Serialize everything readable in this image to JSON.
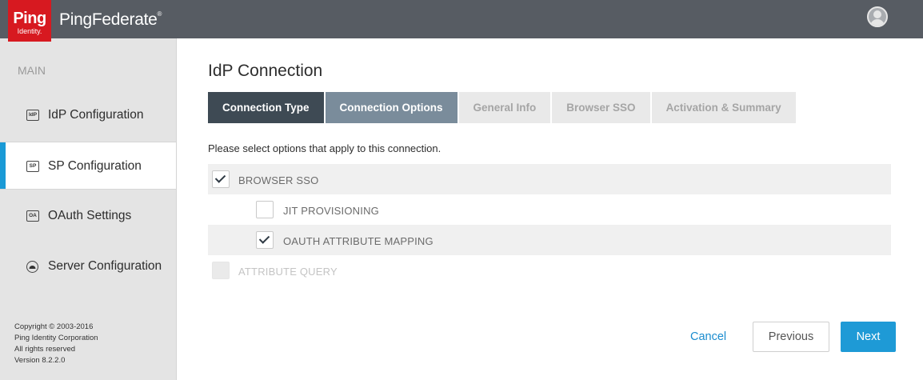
{
  "header": {
    "logo_main": "Ping",
    "logo_sub": "Identity.",
    "product_name": "PingFederate",
    "trademark": "®",
    "user_icon": "user-avatar-icon"
  },
  "sidebar": {
    "heading": "MAIN",
    "items": [
      {
        "label": "IdP Configuration",
        "icon_text": "IdP",
        "icon": "idp-icon",
        "active": false
      },
      {
        "label": "SP Configuration",
        "icon_text": "SP",
        "icon": "sp-icon",
        "active": true
      },
      {
        "label": "OAuth Settings",
        "icon_text": "OA",
        "icon": "oauth-icon",
        "active": false
      },
      {
        "label": "Server Configuration",
        "icon_text": "",
        "icon": "server-icon",
        "active": false
      }
    ],
    "copyright_lines": [
      "Copyright © 2003-2016",
      "Ping Identity Corporation",
      "All rights reserved",
      "Version 8.2.2.0"
    ]
  },
  "main": {
    "title": "IdP Connection",
    "tabs": [
      {
        "label": "Connection Type",
        "state": "done"
      },
      {
        "label": "Connection Options",
        "state": "current"
      },
      {
        "label": "General Info",
        "state": "pending"
      },
      {
        "label": "Browser SSO",
        "state": "pending"
      },
      {
        "label": "Activation & Summary",
        "state": "pending"
      }
    ],
    "instructions": "Please select options that apply to this connection.",
    "options": [
      {
        "label": "BROWSER SSO",
        "checked": true,
        "disabled": false
      },
      {
        "label": "JIT PROVISIONING",
        "checked": false,
        "disabled": false
      },
      {
        "label": "OAUTH ATTRIBUTE MAPPING",
        "checked": true,
        "disabled": false
      },
      {
        "label": "ATTRIBUTE QUERY",
        "checked": false,
        "disabled": true
      }
    ]
  },
  "footer": {
    "cancel_label": "Cancel",
    "previous_label": "Previous",
    "next_label": "Next"
  },
  "colors": {
    "header_bg": "#575c63",
    "brand_red": "#d71920",
    "accent_blue": "#1e9ad6",
    "tab_done": "#3e4a54",
    "tab_current": "#7a8c9b"
  }
}
